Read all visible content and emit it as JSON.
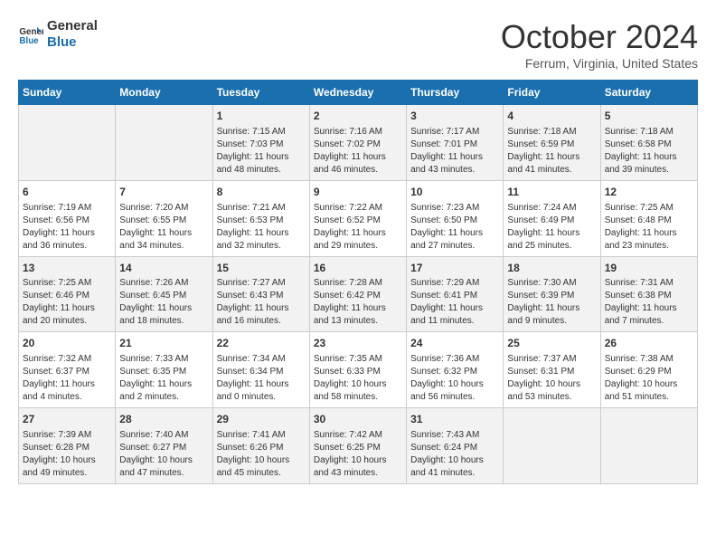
{
  "logo": {
    "line1": "General",
    "line2": "Blue"
  },
  "title": "October 2024",
  "subtitle": "Ferrum, Virginia, United States",
  "days_of_week": [
    "Sunday",
    "Monday",
    "Tuesday",
    "Wednesday",
    "Thursday",
    "Friday",
    "Saturday"
  ],
  "weeks": [
    [
      {
        "day": "",
        "info": ""
      },
      {
        "day": "",
        "info": ""
      },
      {
        "day": "1",
        "info": "Sunrise: 7:15 AM\nSunset: 7:03 PM\nDaylight: 11 hours\nand 48 minutes."
      },
      {
        "day": "2",
        "info": "Sunrise: 7:16 AM\nSunset: 7:02 PM\nDaylight: 11 hours\nand 46 minutes."
      },
      {
        "day": "3",
        "info": "Sunrise: 7:17 AM\nSunset: 7:01 PM\nDaylight: 11 hours\nand 43 minutes."
      },
      {
        "day": "4",
        "info": "Sunrise: 7:18 AM\nSunset: 6:59 PM\nDaylight: 11 hours\nand 41 minutes."
      },
      {
        "day": "5",
        "info": "Sunrise: 7:18 AM\nSunset: 6:58 PM\nDaylight: 11 hours\nand 39 minutes."
      }
    ],
    [
      {
        "day": "6",
        "info": "Sunrise: 7:19 AM\nSunset: 6:56 PM\nDaylight: 11 hours\nand 36 minutes."
      },
      {
        "day": "7",
        "info": "Sunrise: 7:20 AM\nSunset: 6:55 PM\nDaylight: 11 hours\nand 34 minutes."
      },
      {
        "day": "8",
        "info": "Sunrise: 7:21 AM\nSunset: 6:53 PM\nDaylight: 11 hours\nand 32 minutes."
      },
      {
        "day": "9",
        "info": "Sunrise: 7:22 AM\nSunset: 6:52 PM\nDaylight: 11 hours\nand 29 minutes."
      },
      {
        "day": "10",
        "info": "Sunrise: 7:23 AM\nSunset: 6:50 PM\nDaylight: 11 hours\nand 27 minutes."
      },
      {
        "day": "11",
        "info": "Sunrise: 7:24 AM\nSunset: 6:49 PM\nDaylight: 11 hours\nand 25 minutes."
      },
      {
        "day": "12",
        "info": "Sunrise: 7:25 AM\nSunset: 6:48 PM\nDaylight: 11 hours\nand 23 minutes."
      }
    ],
    [
      {
        "day": "13",
        "info": "Sunrise: 7:25 AM\nSunset: 6:46 PM\nDaylight: 11 hours\nand 20 minutes."
      },
      {
        "day": "14",
        "info": "Sunrise: 7:26 AM\nSunset: 6:45 PM\nDaylight: 11 hours\nand 18 minutes."
      },
      {
        "day": "15",
        "info": "Sunrise: 7:27 AM\nSunset: 6:43 PM\nDaylight: 11 hours\nand 16 minutes."
      },
      {
        "day": "16",
        "info": "Sunrise: 7:28 AM\nSunset: 6:42 PM\nDaylight: 11 hours\nand 13 minutes."
      },
      {
        "day": "17",
        "info": "Sunrise: 7:29 AM\nSunset: 6:41 PM\nDaylight: 11 hours\nand 11 minutes."
      },
      {
        "day": "18",
        "info": "Sunrise: 7:30 AM\nSunset: 6:39 PM\nDaylight: 11 hours\nand 9 minutes."
      },
      {
        "day": "19",
        "info": "Sunrise: 7:31 AM\nSunset: 6:38 PM\nDaylight: 11 hours\nand 7 minutes."
      }
    ],
    [
      {
        "day": "20",
        "info": "Sunrise: 7:32 AM\nSunset: 6:37 PM\nDaylight: 11 hours\nand 4 minutes."
      },
      {
        "day": "21",
        "info": "Sunrise: 7:33 AM\nSunset: 6:35 PM\nDaylight: 11 hours\nand 2 minutes."
      },
      {
        "day": "22",
        "info": "Sunrise: 7:34 AM\nSunset: 6:34 PM\nDaylight: 11 hours\nand 0 minutes."
      },
      {
        "day": "23",
        "info": "Sunrise: 7:35 AM\nSunset: 6:33 PM\nDaylight: 10 hours\nand 58 minutes."
      },
      {
        "day": "24",
        "info": "Sunrise: 7:36 AM\nSunset: 6:32 PM\nDaylight: 10 hours\nand 56 minutes."
      },
      {
        "day": "25",
        "info": "Sunrise: 7:37 AM\nSunset: 6:31 PM\nDaylight: 10 hours\nand 53 minutes."
      },
      {
        "day": "26",
        "info": "Sunrise: 7:38 AM\nSunset: 6:29 PM\nDaylight: 10 hours\nand 51 minutes."
      }
    ],
    [
      {
        "day": "27",
        "info": "Sunrise: 7:39 AM\nSunset: 6:28 PM\nDaylight: 10 hours\nand 49 minutes."
      },
      {
        "day": "28",
        "info": "Sunrise: 7:40 AM\nSunset: 6:27 PM\nDaylight: 10 hours\nand 47 minutes."
      },
      {
        "day": "29",
        "info": "Sunrise: 7:41 AM\nSunset: 6:26 PM\nDaylight: 10 hours\nand 45 minutes."
      },
      {
        "day": "30",
        "info": "Sunrise: 7:42 AM\nSunset: 6:25 PM\nDaylight: 10 hours\nand 43 minutes."
      },
      {
        "day": "31",
        "info": "Sunrise: 7:43 AM\nSunset: 6:24 PM\nDaylight: 10 hours\nand 41 minutes."
      },
      {
        "day": "",
        "info": ""
      },
      {
        "day": "",
        "info": ""
      }
    ]
  ]
}
